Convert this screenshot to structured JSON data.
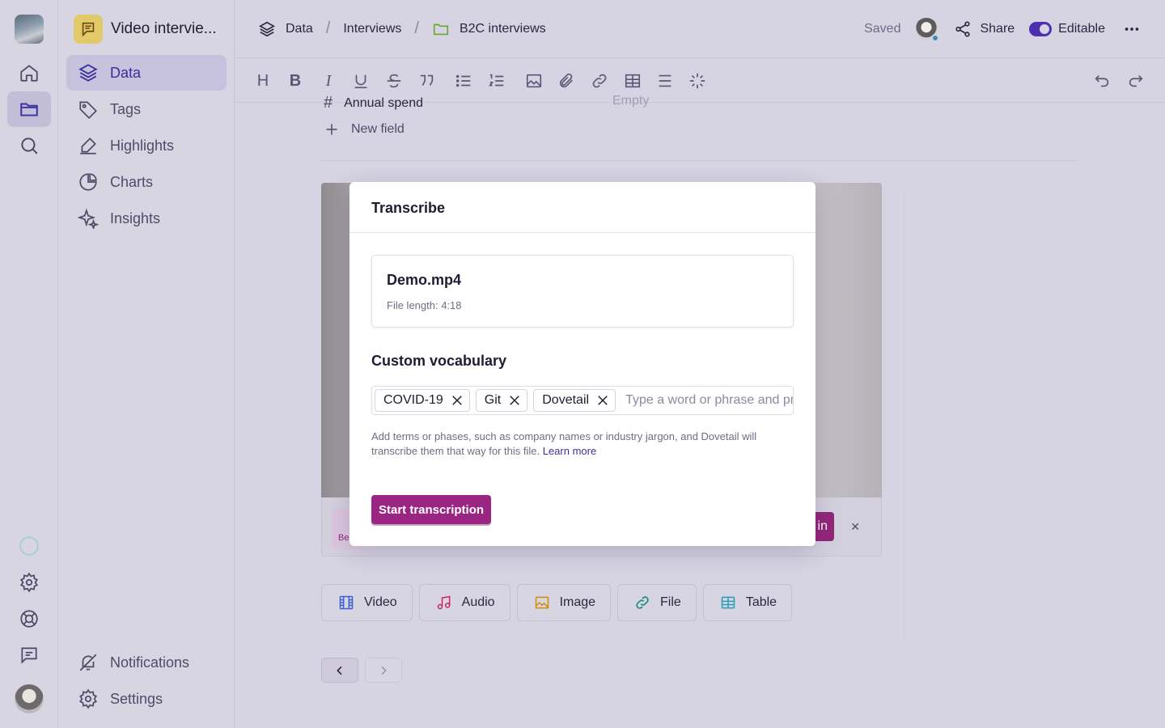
{
  "project": {
    "title": "Video intervie..."
  },
  "nav": {
    "items": [
      {
        "label": "Data",
        "icon": "layers-icon"
      },
      {
        "label": "Tags",
        "icon": "tag-icon"
      },
      {
        "label": "Highlights",
        "icon": "highlighter-icon"
      },
      {
        "label": "Charts",
        "icon": "pie-chart-icon"
      },
      {
        "label": "Insights",
        "icon": "sparkles-icon"
      }
    ],
    "bottom": [
      {
        "label": "Notifications",
        "icon": "bell-off-icon"
      },
      {
        "label": "Settings",
        "icon": "gear-icon"
      }
    ]
  },
  "breadcrumbs": [
    "Data",
    "Interviews",
    "B2C interviews"
  ],
  "topbar": {
    "saved": "Saved",
    "share": "Share",
    "editable": "Editable",
    "editable_on": true
  },
  "toolbar": {
    "heading": "H",
    "bold": "B",
    "italic": "I"
  },
  "content": {
    "field_label": "Annual spend",
    "field_value": "Empty",
    "new_field": "New field",
    "video_bar_thumb_text": "Be",
    "video_bar_button": "in",
    "media_buttons": [
      "Video",
      "Audio",
      "Image",
      "File",
      "Table"
    ]
  },
  "modal": {
    "title": "Transcribe",
    "file_name": "Demo.mp4",
    "file_length": "File length: 4:18",
    "vocab_title": "Custom vocabulary",
    "chips": [
      "COVID-19",
      "Git",
      "Dovetail"
    ],
    "input_placeholder": "Type a word or phrase and press enter",
    "help_text": "Add terms or phases, such as company names or industry jargon, and Dovetail will transcribe them that way for this file.",
    "help_link": "Learn more",
    "start_button": "Start transcription"
  },
  "colors": {
    "accent": "#3b2fa0",
    "primary_button": "#9a2582",
    "toggle": "#4c2fb0"
  }
}
